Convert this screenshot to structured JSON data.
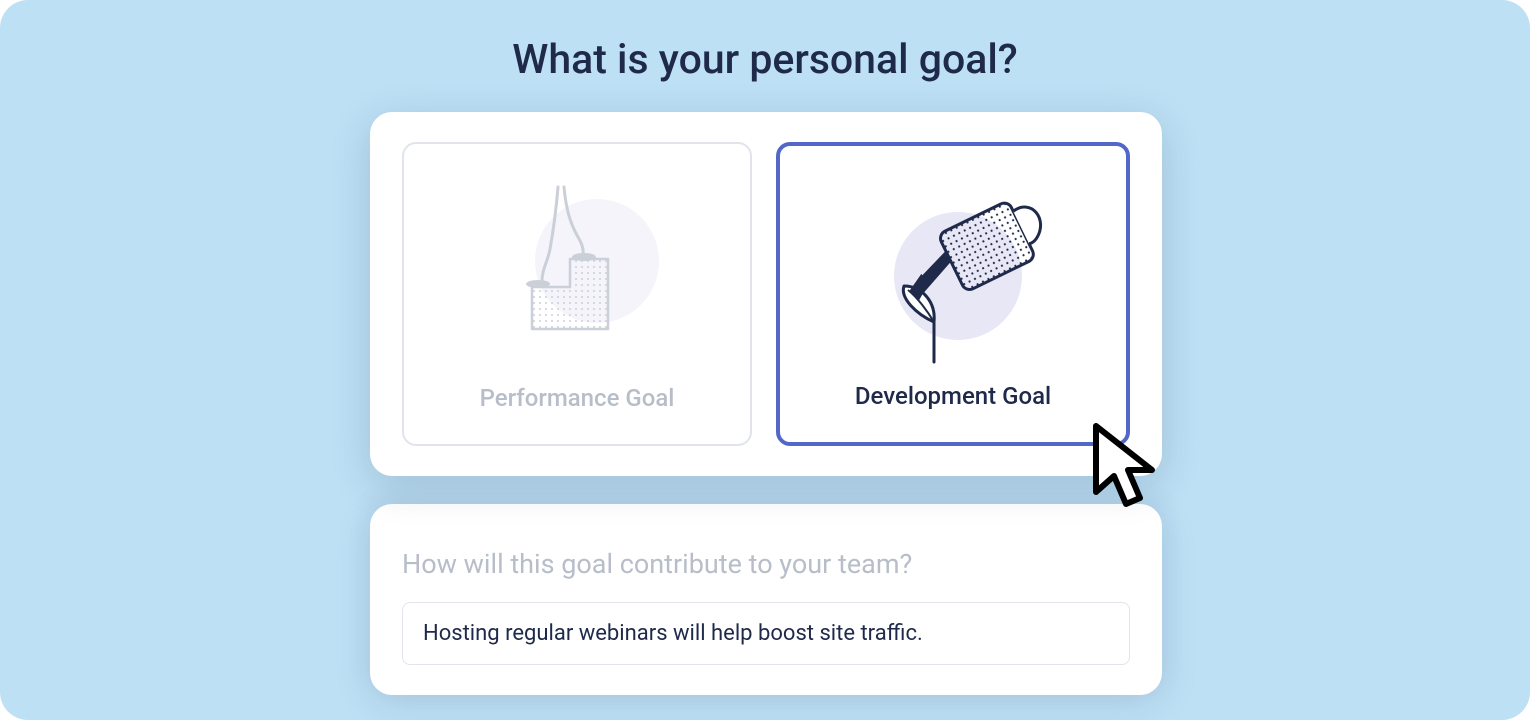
{
  "heading": "What is your personal goal?",
  "options": [
    {
      "label": "Performance Goal",
      "selected": false
    },
    {
      "label": "Development Goal",
      "selected": true
    }
  ],
  "subquestion": "How will this goal contribute to your team?",
  "answer": "Hosting regular webinars will help boost site traffic.",
  "colors": {
    "background": "#bde0f5",
    "text_dark": "#1f2a4a",
    "text_muted": "#b7bec9",
    "accent": "#5367c8",
    "lavender": "#e7e7f5"
  }
}
